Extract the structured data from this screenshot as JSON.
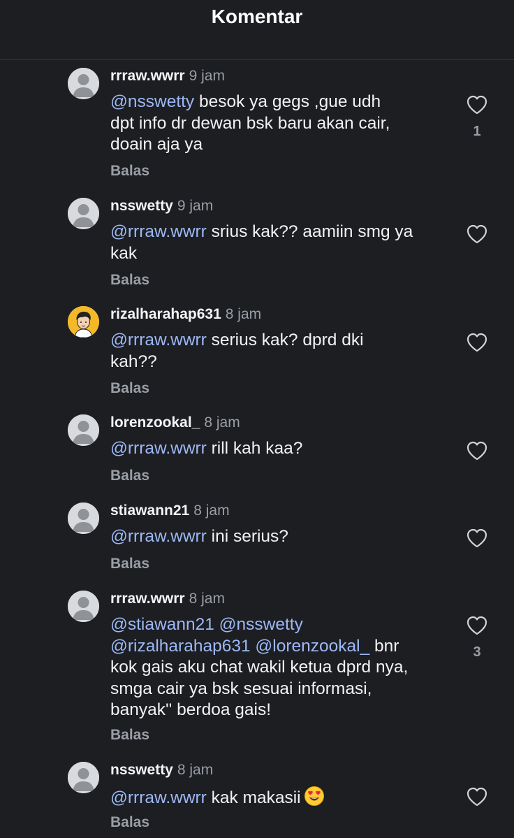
{
  "header": {
    "title": "Komentar"
  },
  "icons": {
    "like": "heart-outline-icon",
    "avatar_default": "default-avatar-icon",
    "emoji": "heart-eyes-emoji"
  },
  "comments": [
    {
      "username": "rrraw.wwrr",
      "time": "9 jam",
      "lines": [
        [
          {
            "t": "@nsswetty",
            "m": true
          },
          {
            "t": " besok ya  gegs ,gue udh",
            "m": false
          }
        ],
        [
          {
            "t": "dpt info dr dewan bsk baru akan cair,",
            "m": false
          }
        ],
        [
          {
            "t": "doain aja ya",
            "m": false
          }
        ]
      ],
      "reply": "Balas",
      "likes": "1"
    },
    {
      "username": "nsswetty",
      "time": "9 jam",
      "lines": [
        [
          {
            "t": "@rrraw.wwrr",
            "m": true
          },
          {
            "t": " srius kak?? aamiin smg ya",
            "m": false
          }
        ],
        [
          {
            "t": "kak",
            "m": false
          }
        ]
      ],
      "reply": "Balas",
      "likes": ""
    },
    {
      "username": "rizalharahap631",
      "time": "8 jam",
      "lines": [
        [
          {
            "t": "@rrraw.wwrr",
            "m": true
          },
          {
            "t": " serius kak? dprd dki",
            "m": false
          }
        ],
        [
          {
            "t": "kah??",
            "m": false
          }
        ]
      ],
      "reply": "Balas",
      "likes": ""
    },
    {
      "username": "lorenzookal_",
      "time": "8 jam",
      "lines": [
        [
          {
            "t": "@rrraw.wwrr",
            "m": true
          },
          {
            "t": " rill kah kaa?",
            "m": false
          }
        ]
      ],
      "reply": "Balas",
      "likes": ""
    },
    {
      "username": "stiawann21",
      "time": "8 jam",
      "lines": [
        [
          {
            "t": "@rrraw.wwrr",
            "m": true
          },
          {
            "t": " ini serius?",
            "m": false
          }
        ]
      ],
      "reply": "Balas",
      "likes": ""
    },
    {
      "username": "rrraw.wwrr",
      "time": "8 jam",
      "lines": [
        [
          {
            "t": "@stiawann21",
            "m": true
          },
          {
            "t": " ",
            "m": false
          },
          {
            "t": "@nsswetty",
            "m": true
          }
        ],
        [
          {
            "t": "@rizalharahap631",
            "m": true
          },
          {
            "t": " ",
            "m": false
          },
          {
            "t": "@lorenzookal_",
            "m": true
          },
          {
            "t": " bnr",
            "m": false
          }
        ],
        [
          {
            "t": "kok gais aku chat wakil ketua dprd nya,",
            "m": false
          }
        ],
        [
          {
            "t": "smga cair ya bsk sesuai informasi,",
            "m": false
          }
        ],
        [
          {
            "t": "banyak'' berdoa gais!",
            "m": false
          }
        ]
      ],
      "reply": "Balas",
      "likes": "3"
    },
    {
      "username": "nsswetty",
      "time": "8 jam",
      "lines": [
        [
          {
            "t": "@rrraw.wwrr",
            "m": true
          },
          {
            "t": " kak makasii",
            "m": false
          }
        ]
      ],
      "reply": "Balas",
      "likes": ""
    }
  ]
}
